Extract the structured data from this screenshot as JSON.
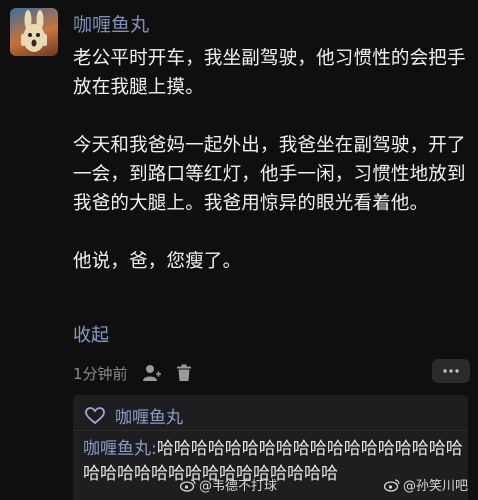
{
  "post": {
    "username": "咖喱鱼丸",
    "paragraphs": [
      "老公平时开车，我坐副驾驶，他习惯性的会把手放在我腿上摸。",
      "今天和我爸妈一起外出，我爸坐在副驾驶，开了一会，到路口等红灯，他手一闲，习惯性地放到我爸的大腿上。我爸用惊异的眼光看着他。",
      "他说，爸，您瘦了。"
    ],
    "collapse_label": "收起",
    "timestamp": "1分钟前"
  },
  "reply_box": {
    "liker_name": "咖喱鱼丸",
    "reply_author": "咖喱鱼丸:",
    "reply_content": "哈哈哈哈哈哈哈哈哈哈哈哈哈哈哈哈哈哈哈哈哈哈哈哈哈哈哈哈哈哈哈哈哈"
  },
  "watermarks": {
    "left": "@韦德不打球",
    "right": "@孙笑川吧"
  },
  "icons": {
    "user": "user-icon",
    "delete": "trash-icon",
    "more": "more-dots-icon",
    "like": "heart-icon",
    "weibo": "weibo-logo-icon"
  },
  "colors": {
    "background": "#0f0f10",
    "link": "#8a9cc6",
    "text": "#f2f2f2"
  }
}
